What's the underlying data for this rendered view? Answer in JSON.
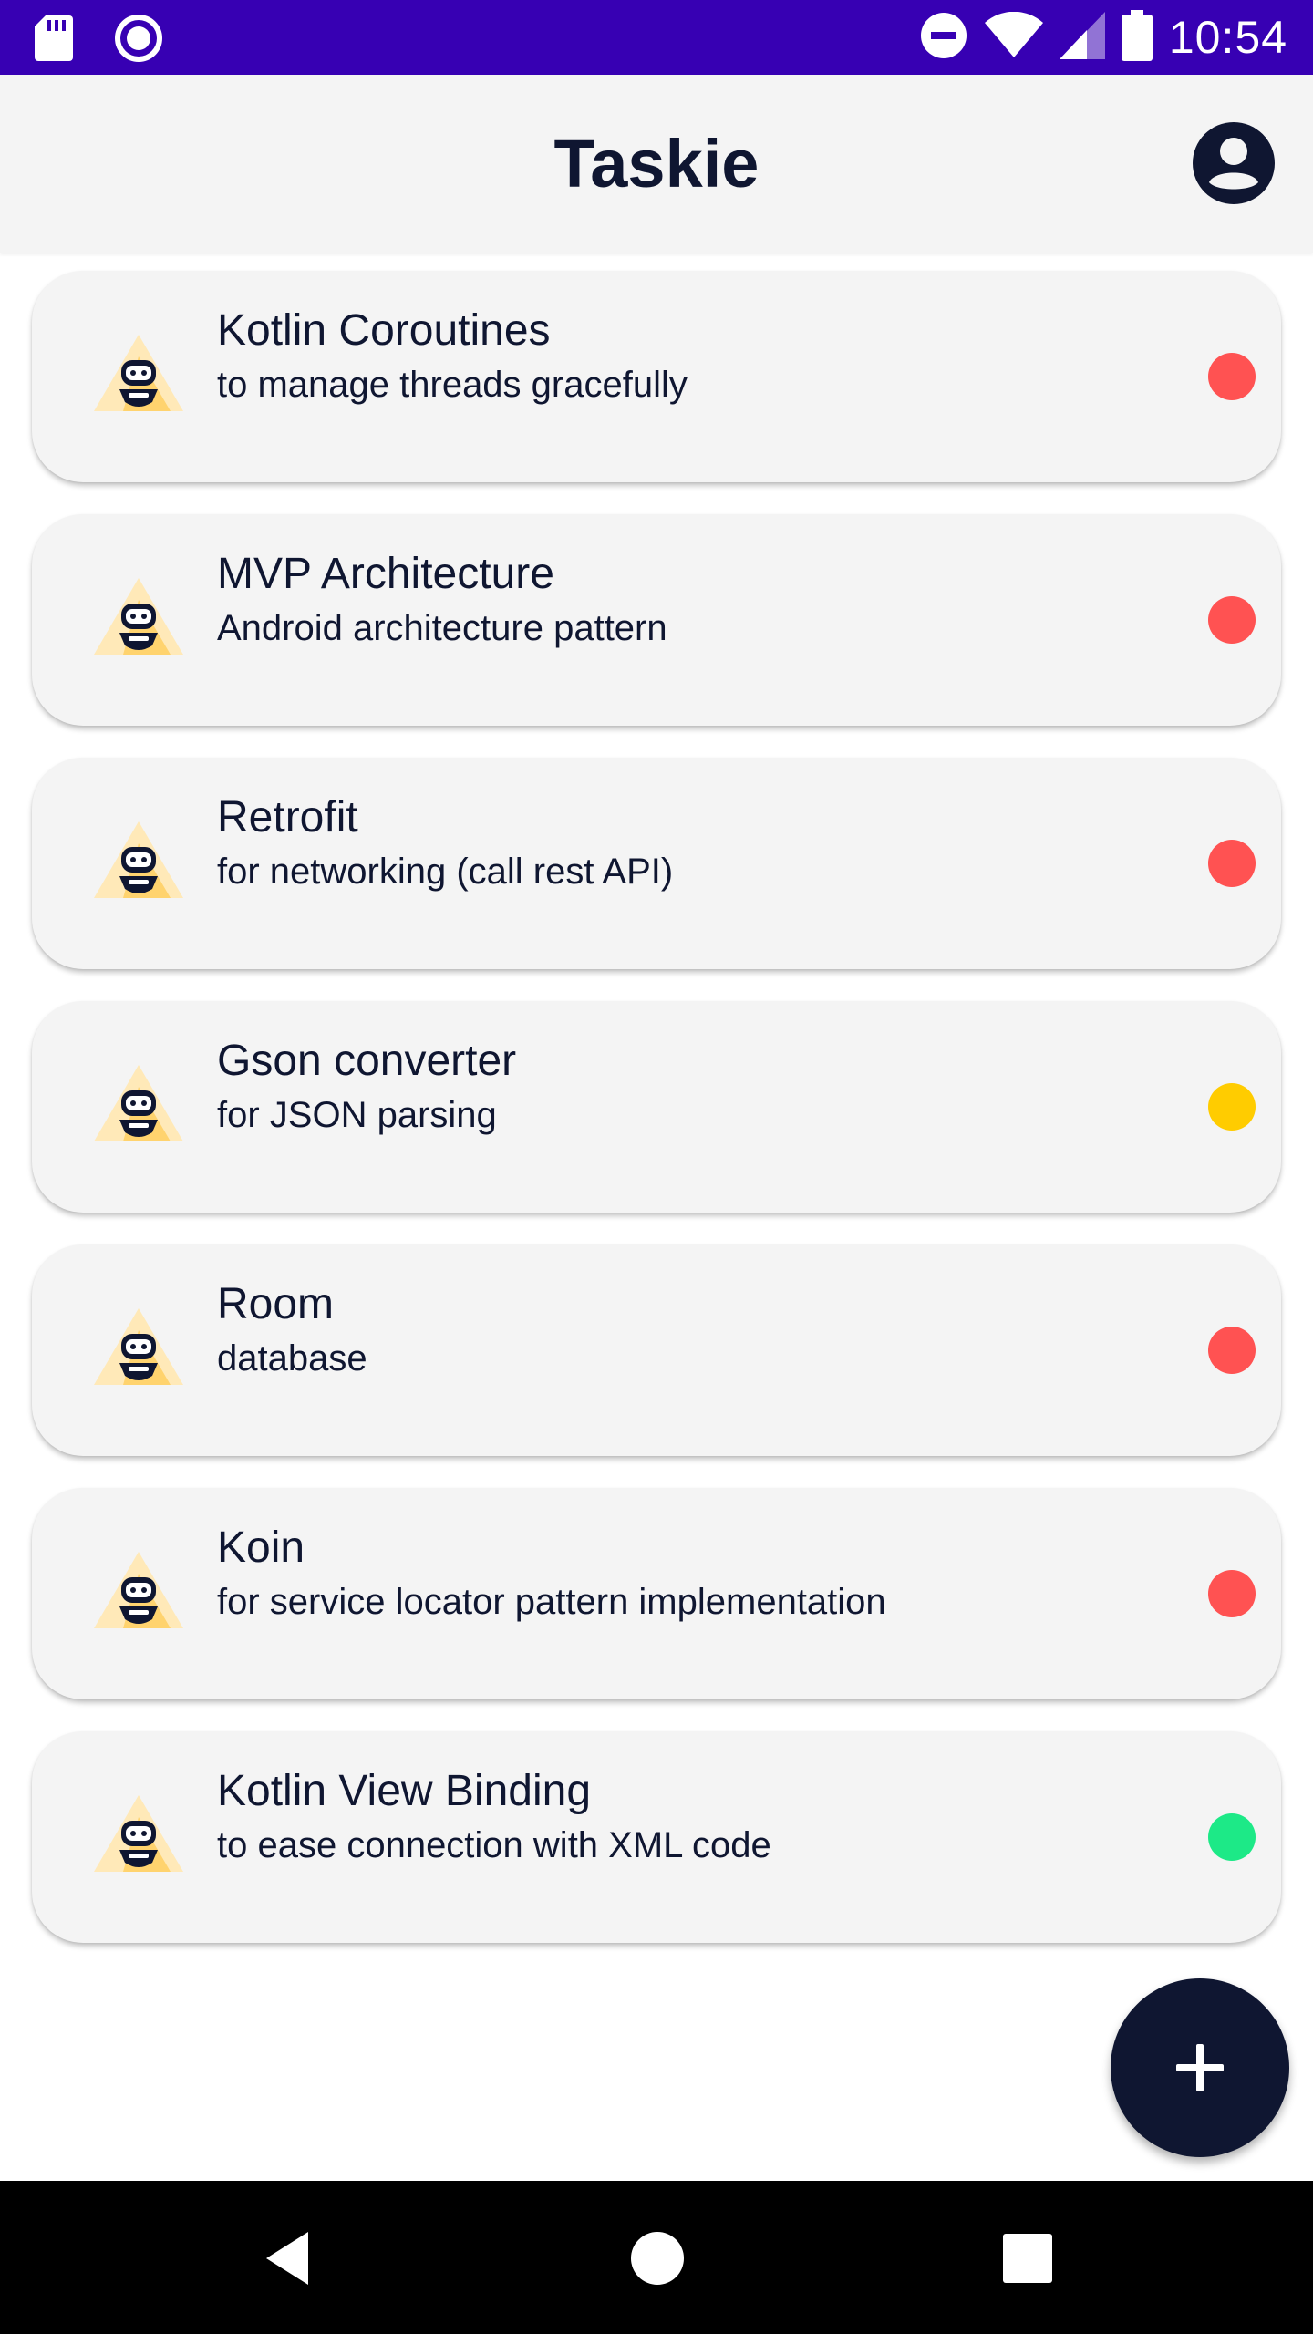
{
  "status_bar": {
    "time": "10:54",
    "icons": [
      "sd-card-icon",
      "record-icon",
      "do-not-disturb-icon",
      "wifi-icon",
      "signal-icon",
      "battery-icon"
    ]
  },
  "app_bar": {
    "title": "Taskie",
    "profile_icon": "account-circle-icon"
  },
  "tasks": [
    {
      "title": "Kotlin Coroutines",
      "description": "to manage threads gracefully",
      "priority_color": "#ff5252"
    },
    {
      "title": "MVP Architecture",
      "description": "Android architecture pattern",
      "priority_color": "#ff5252"
    },
    {
      "title": "Retrofit",
      "description": "for networking (call rest API)",
      "priority_color": "#ff5252"
    },
    {
      "title": "Gson converter",
      "description": "for JSON parsing",
      "priority_color": "#ffcc00"
    },
    {
      "title": "Room",
      "description": "database",
      "priority_color": "#ff5252"
    },
    {
      "title": "Koin",
      "description": "for service locator pattern implementation",
      "priority_color": "#ff5252"
    },
    {
      "title": "Kotlin View Binding",
      "description": "to ease connection with XML code",
      "priority_color": "#1de987"
    }
  ],
  "fab": {
    "icon": "add-icon"
  },
  "nav_bar": {
    "icons": [
      "back-icon",
      "home-icon",
      "recents-icon"
    ]
  },
  "colors": {
    "status_bar": "#3700b3",
    "primary_dark": "#0f1631",
    "card_background": "#f4f4f4",
    "priority_high": "#ff5252",
    "priority_medium": "#ffcc00",
    "priority_low": "#1de987"
  }
}
